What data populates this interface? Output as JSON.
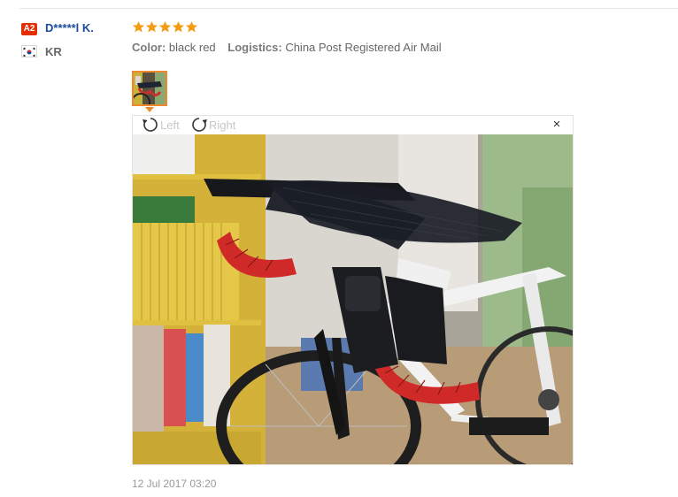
{
  "reviewer": {
    "level_badge": "A2",
    "name": "D*****l K.",
    "country_code": "KR"
  },
  "rating": {
    "stars": 5,
    "max": 5,
    "star_color": "#f39c12"
  },
  "order_info": {
    "color_key": "Color:",
    "color_value": "black red",
    "logistics_key": "Logistics:",
    "logistics_value": "China Post Registered Air Mail"
  },
  "viewer": {
    "rotate_left_label": "Left",
    "rotate_right_label": "Right",
    "close_glyph": "×"
  },
  "review_date": "12 Jul 2017 03:20",
  "colors": {
    "accent_orange": "#f0882e",
    "badge_red": "#e62e04",
    "name_blue": "#1c4c9c"
  }
}
